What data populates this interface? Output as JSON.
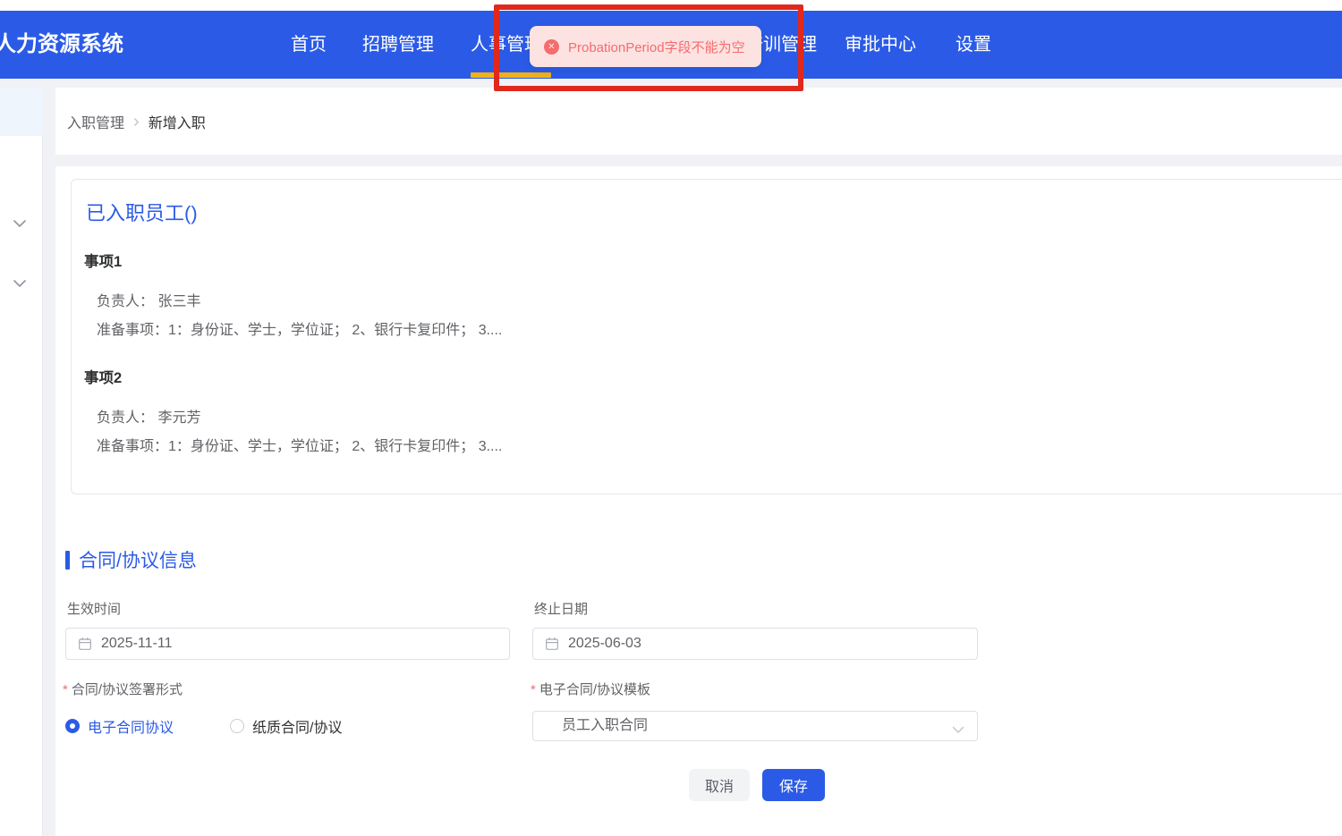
{
  "app_title": "人力资源系统",
  "nav": {
    "items": [
      {
        "label": "首页"
      },
      {
        "label": "招聘管理"
      },
      {
        "label": "人事管理"
      },
      {
        "label": "培训管理"
      },
      {
        "label": "审批中心"
      },
      {
        "label": "设置"
      }
    ],
    "active": "人事管理"
  },
  "toast": {
    "type": "error",
    "message": "ProbationPeriod字段不能为空"
  },
  "breadcrumb": {
    "items": [
      {
        "label": "入职管理"
      },
      {
        "label": "新增入职"
      }
    ],
    "separator": "›"
  },
  "employee_card": {
    "title": "已入职员工()",
    "items": [
      {
        "heading": "事项1",
        "owner": "负责人： 张三丰",
        "preparation": "准备事项：1：身份证、学士，学位证； 2、银行卡复印件； 3...."
      },
      {
        "heading": "事项2",
        "owner": "负责人： 李元芳",
        "preparation": "准备事项：1：身份证、学士，学位证； 2、银行卡复印件； 3...."
      }
    ]
  },
  "contract": {
    "section_title": "合同/协议信息",
    "effective_date": {
      "label": "生效时间",
      "value": "2025-11-11"
    },
    "end_date": {
      "label": "终止日期",
      "value": "2025-06-03"
    },
    "sign_type": {
      "required_mark": "*",
      "label": "合同/协议签署形式",
      "options": [
        {
          "label": "电子合同协议",
          "selected": true
        },
        {
          "label": "纸质合同/协议",
          "selected": false
        }
      ]
    },
    "template": {
      "required_mark": "*",
      "label": "电子合同/协议模板",
      "value": "员工入职合同"
    }
  },
  "actions": {
    "cancel": "取消",
    "save": "保存"
  },
  "icons": {
    "toast": "error-circle-icon",
    "date_fields": "calendar-icon",
    "select": "chevron-down-icon",
    "sidebar": "chevron-down-icon"
  },
  "colors": {
    "primary_blue": "#2b5be6",
    "active_tab_underline": "#efb019",
    "error_text": "#f56c6c",
    "error_background": "#fde2e2",
    "annotation_red": "#e0291c"
  }
}
